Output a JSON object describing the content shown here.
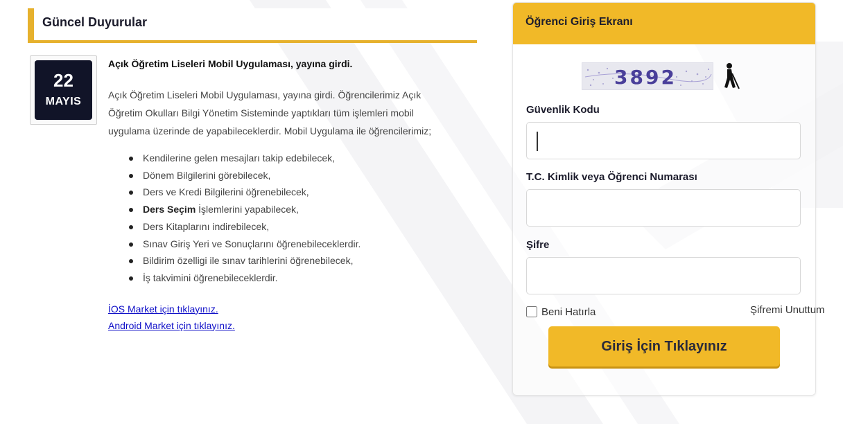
{
  "news": {
    "header_title": "Güncel Duyurular",
    "date": {
      "day": "22",
      "month": "MAYIS"
    },
    "article": {
      "title": "Açık Öğretim Liseleri Mobil Uygulaması, yayına girdi.",
      "body_lines": [
        "Açık Öğretim Liseleri Mobil Uygulaması, yayına girdi. Öğrencilerimiz Açık",
        "Öğretim Okulları Bilgi Yönetim Sisteminde yaptıkları tüm işlemleri mobil",
        "uygulama üzerinde de yapabileceklerdir. Mobil Uygulama ile öğrencilerimiz;"
      ],
      "features": [
        {
          "bold": "",
          "text": "Kendilerine gelen mesajları takip edebilecek,"
        },
        {
          "bold": "",
          "text": "Dönem Bilgilerini görebilecek,"
        },
        {
          "bold": "",
          "text": "Ders ve Kredi Bilgilerini öğrenebilecek,"
        },
        {
          "bold": "Ders Seçim",
          "text": " İşlemlerini yapabilecek,"
        },
        {
          "bold": "",
          "text": "Ders Kitaplarını indirebilecek,"
        },
        {
          "bold": "",
          "text": "Sınav Giriş Yeri ve Sonuçlarını öğrenebileceklerdir."
        },
        {
          "bold": "",
          "text": "Bildirim özelligi ile sınav tarihlerini öğrenebilecek,"
        },
        {
          "bold": "",
          "text": "İş takvimini öğrenebileceklerdir."
        }
      ],
      "links": {
        "ios": "İOS Market için tıklayınız.",
        "android": "Android Market için tıklayınız."
      }
    }
  },
  "login": {
    "header_title": "Öğrenci Giriş Ekranı",
    "captcha_code": "3892",
    "security_code_label": "Güvenlik Kodu",
    "security_code_value": "",
    "id_label": "T.C. Kimlik veya Öğrenci Numarası",
    "id_value": "",
    "password_label": "Şifre",
    "password_value": "",
    "remember_label": "Beni Hatırla",
    "remember_checked": false,
    "forgot_label": "Şifremi Unuttum",
    "submit_label": "Giriş İçin Tıklayınız"
  },
  "colors": {
    "accent": "#f1b928",
    "dark": "#111428",
    "link": "#1010c8"
  }
}
